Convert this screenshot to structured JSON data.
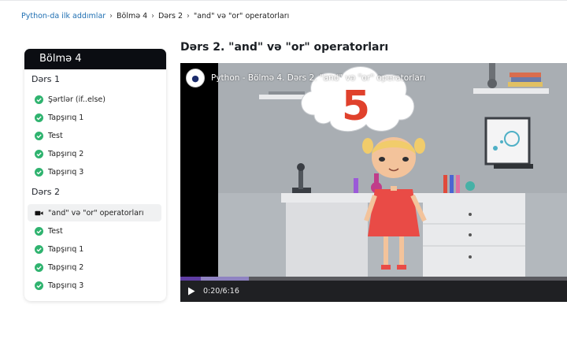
{
  "breadcrumb": {
    "course": "Python-da ilk addımlar",
    "section": "Bölmə 4",
    "lesson": "Dərs 2",
    "current": "\"and\" və \"or\" operatorları",
    "separator": "›"
  },
  "page": {
    "title": "Dərs 2. \"and\" və \"or\" operatorları"
  },
  "sidebar": {
    "header": "Bölmə 4",
    "sections": [
      {
        "title": "Dərs 1",
        "items": [
          {
            "label": "Şərtlər (if..else)",
            "icon": "check-circle-icon"
          },
          {
            "label": "Tapşırıq 1",
            "icon": "check-circle-icon"
          },
          {
            "label": "Test",
            "icon": "check-circle-icon"
          },
          {
            "label": "Tapşırıq 2",
            "icon": "check-circle-icon"
          },
          {
            "label": "Tapşırıq 3",
            "icon": "check-circle-icon"
          }
        ]
      },
      {
        "title": "Dərs 2",
        "items": [
          {
            "label": "\"and\" və \"or\" operatorları",
            "icon": "video-camera-icon",
            "active": true
          },
          {
            "label": "Test",
            "icon": "check-circle-icon"
          },
          {
            "label": "Tapşırıq 1",
            "icon": "check-circle-icon"
          },
          {
            "label": "Tapşırıq 2",
            "icon": "check-circle-icon"
          },
          {
            "label": "Tapşırıq 3",
            "icon": "check-circle-icon"
          }
        ]
      }
    ]
  },
  "video": {
    "title": "Python - Bölmə 4. Dərs 2. \"and\" və \"or\" operatorları",
    "time": "0:20/6:16",
    "progress_fraction": 0.053,
    "buffered_fraction": 0.177,
    "scene_number": "5"
  },
  "colors": {
    "check": "#2fb36f",
    "progress": "#5f3da3",
    "header_bg": "#0b0d12",
    "link": "#1f6fb2"
  }
}
